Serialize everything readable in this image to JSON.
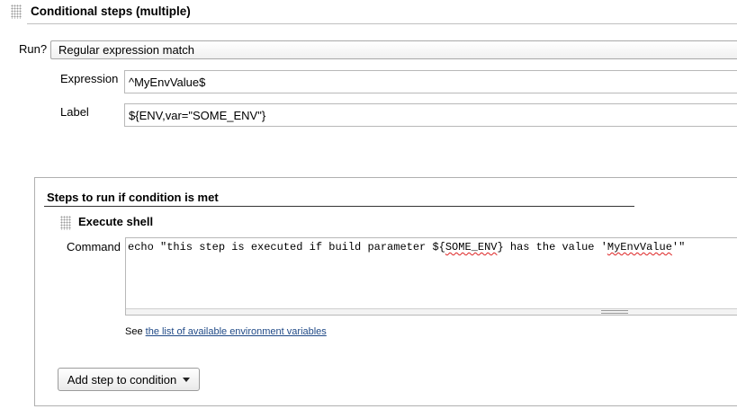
{
  "header": {
    "title": "Conditional steps (multiple)"
  },
  "run": {
    "label": "Run?",
    "selected": "Regular expression match"
  },
  "expression": {
    "label": "Expression",
    "value": "^MyEnvValue$"
  },
  "label_field": {
    "label": "Label",
    "value": "${ENV,var=\"SOME_ENV\"}"
  },
  "steps": {
    "title": "Steps to run if condition is met",
    "execute_shell": {
      "title": "Execute shell",
      "command_label": "Command",
      "command_parts": [
        "echo \"this step is executed if build parameter ${",
        "SOME_ENV",
        "} has the value '",
        "MyEnvValue",
        "'\""
      ],
      "hint_prefix": "See ",
      "hint_link": "the list of available environment variables"
    },
    "add_button_label": "Add step to condition"
  },
  "icons": {
    "drag_handle": "drag-handle-icon",
    "dropdown": "caret-down-icon"
  }
}
